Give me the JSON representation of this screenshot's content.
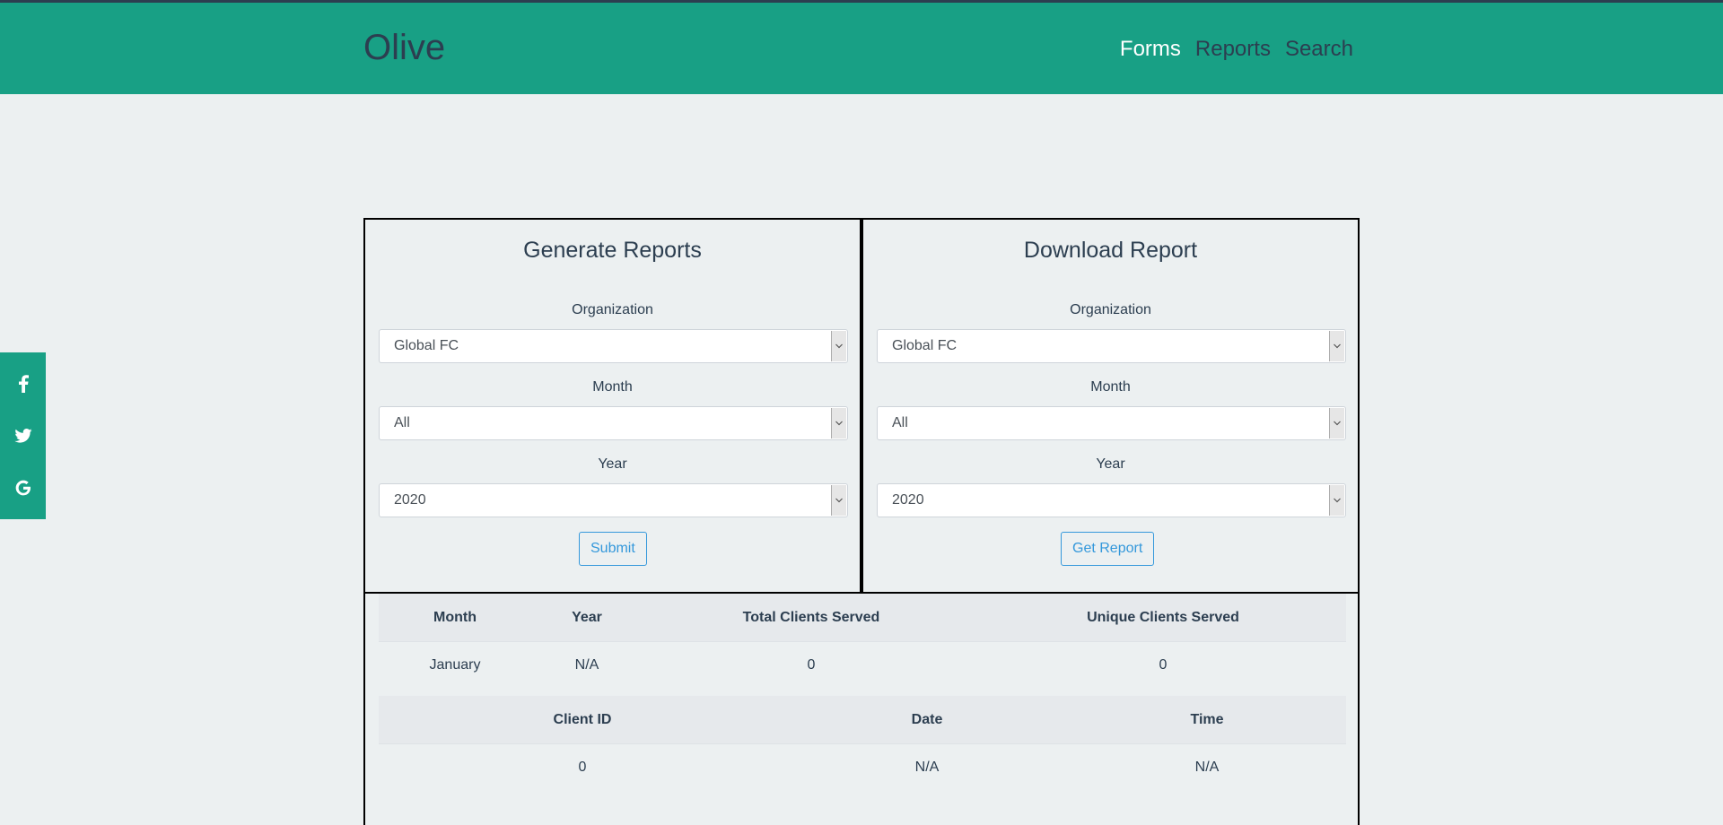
{
  "header": {
    "brand": "Olive",
    "nav": [
      {
        "label": "Forms",
        "active": true
      },
      {
        "label": "Reports",
        "active": false
      },
      {
        "label": "Search",
        "active": false
      }
    ]
  },
  "social": [
    "facebook-icon",
    "twitter-icon",
    "google-icon"
  ],
  "generate": {
    "title": "Generate Reports",
    "org_label": "Organization",
    "org_value": "Global FC",
    "month_label": "Month",
    "month_value": "All",
    "year_label": "Year",
    "year_value": "2020",
    "button": "Submit"
  },
  "download": {
    "title": "Download Report",
    "org_label": "Organization",
    "org_value": "Global FC",
    "month_label": "Month",
    "month_value": "All",
    "year_label": "Year",
    "year_value": "2020",
    "button": "Get Report"
  },
  "summary_table": {
    "headers": [
      "Month",
      "Year",
      "Total Clients Served",
      "Unique Clients Served"
    ],
    "row": [
      "January",
      "N/A",
      "0",
      "0"
    ]
  },
  "detail_table": {
    "headers": [
      "Client ID",
      "Date",
      "Time"
    ],
    "row": [
      "0",
      "N/A",
      "N/A"
    ]
  },
  "colors": {
    "navbar": "#18a085",
    "background": "#ecf0f1",
    "text": "#2c3e50",
    "button": "#3498db"
  }
}
